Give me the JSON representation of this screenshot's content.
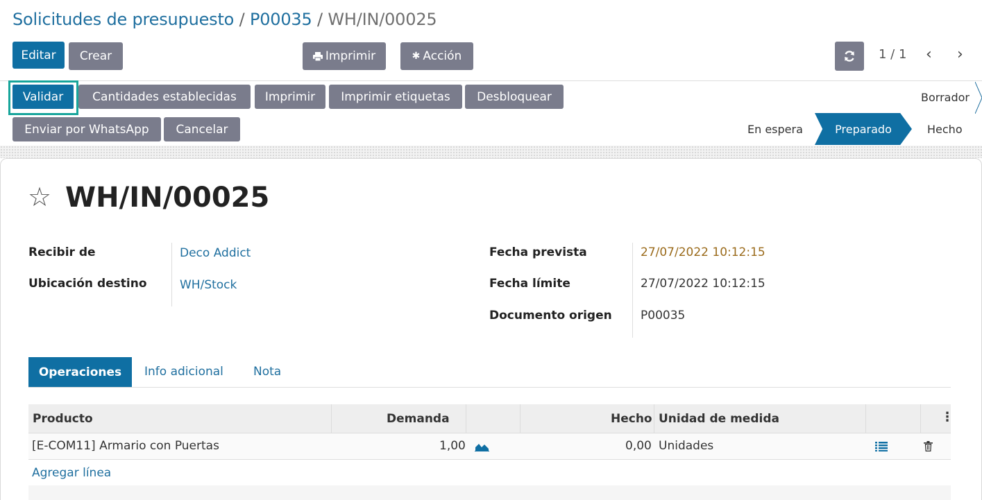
{
  "breadcrumb": {
    "item1": "Solicitudes de presupuesto",
    "sep1": "/",
    "item2": "P00035",
    "sep2": "/",
    "current": "WH/IN/00025"
  },
  "toolbar": {
    "edit": "Editar",
    "create": "Crear",
    "print": "Imprimir",
    "action": "Acción",
    "pager": "1 / 1"
  },
  "actions": {
    "validate": "Validar",
    "set_quantities": "Cantidades establecidas",
    "print": "Imprimir",
    "print_labels": "Imprimir etiquetas",
    "unlock": "Desbloquear",
    "whatsapp": "Enviar por WhatsApp",
    "cancel": "Cancelar"
  },
  "statusbar": {
    "draft": "Borrador",
    "waiting": "En espera",
    "ready": "Preparado",
    "done": "Hecho"
  },
  "record": {
    "title": "WH/IN/00025",
    "receive_from_label": "Recibir de",
    "receive_from": "Deco Addict",
    "dest_location_label": "Ubicación destino",
    "dest_location": "WH/Stock",
    "scheduled_date_label": "Fecha prevista",
    "scheduled_date": "27/07/2022 10:12:15",
    "deadline_label": "Fecha límite",
    "deadline": "27/07/2022 10:12:15",
    "origin_label": "Documento origen",
    "origin": "P00035"
  },
  "tabs": {
    "operations": "Operaciones",
    "extra_info": "Info adicional",
    "note": "Nota"
  },
  "table": {
    "headers": {
      "product": "Producto",
      "demand": "Demanda",
      "done": "Hecho",
      "uom": "Unidad de medida"
    },
    "rows": [
      {
        "product": "[E-COM11] Armario con Puertas",
        "demand": "1,00",
        "done": "0,00",
        "uom": "Unidades"
      }
    ],
    "add_line": "Agregar línea"
  },
  "colors": {
    "primary": "#0f6fa3",
    "secondary": "#7a7c8c",
    "link": "#1f6f9f",
    "highlight": "#17a59b",
    "warning_date": "#9a6a1a"
  }
}
